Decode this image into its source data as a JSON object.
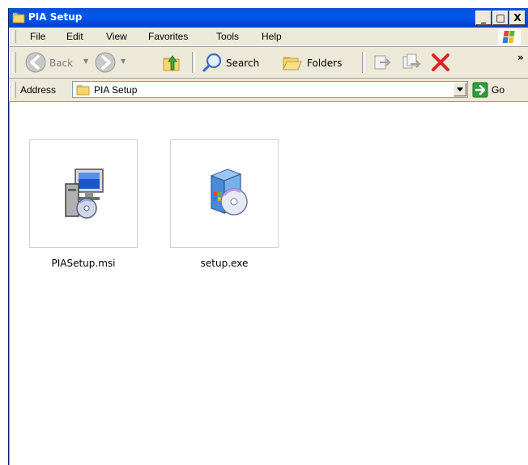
{
  "window": {
    "title": "PIA Setup",
    "minimize_label": "_",
    "maximize_label": "□",
    "close_label": "X"
  },
  "menu": {
    "items": [
      "File",
      "Edit",
      "View",
      "Favorites",
      "Tools",
      "Help"
    ]
  },
  "toolbar": {
    "back_label": "Back",
    "search_label": "Search",
    "folders_label": "Folders",
    "more_label": "»"
  },
  "address": {
    "label": "Address",
    "value": "PIA Setup",
    "go_label": "Go"
  },
  "files": [
    {
      "name": "PIASetup.msi",
      "icon": "msi-installer-icon"
    },
    {
      "name": "setup.exe",
      "icon": "setup-exe-icon"
    }
  ],
  "colors": {
    "titlebar": "#0058ee",
    "chrome": "#ece9d8",
    "delete_red": "#e02020",
    "go_green": "#2e9e3e"
  }
}
